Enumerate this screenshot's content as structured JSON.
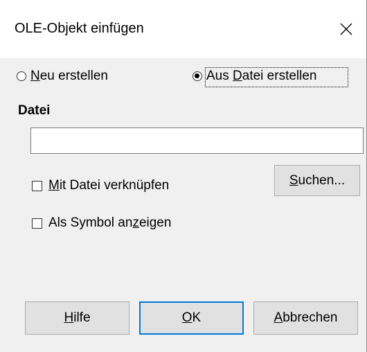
{
  "dialog": {
    "title": "OLE-Objekt einfügen",
    "close_glyph": "✕"
  },
  "options": {
    "new": {
      "pre": "",
      "accel": "N",
      "post": "eu erstellen",
      "checked": false
    },
    "from_file": {
      "pre": "Aus ",
      "accel": "D",
      "post": "atei erstellen",
      "checked": true
    }
  },
  "file": {
    "section_label": "Datei",
    "path_value": "",
    "link": {
      "pre": "",
      "accel": "M",
      "post": "it Datei verknüpfen",
      "checked": false
    },
    "as_icon": {
      "pre": "Als Symbol an",
      "accel": "z",
      "post": "eigen",
      "checked": false
    },
    "search_button": {
      "pre": "",
      "accel": "S",
      "post": "uchen..."
    }
  },
  "buttons": {
    "help": {
      "pre": "",
      "accel": "H",
      "post": "ilfe"
    },
    "ok": {
      "pre": "",
      "accel": "O",
      "post": "K"
    },
    "cancel": {
      "pre": "",
      "accel": "A",
      "post": "bbrechen"
    }
  },
  "colors": {
    "accent": "#0078d7",
    "dialog_bg": "#f0f0f0",
    "button_bg": "#e1e1e1"
  }
}
